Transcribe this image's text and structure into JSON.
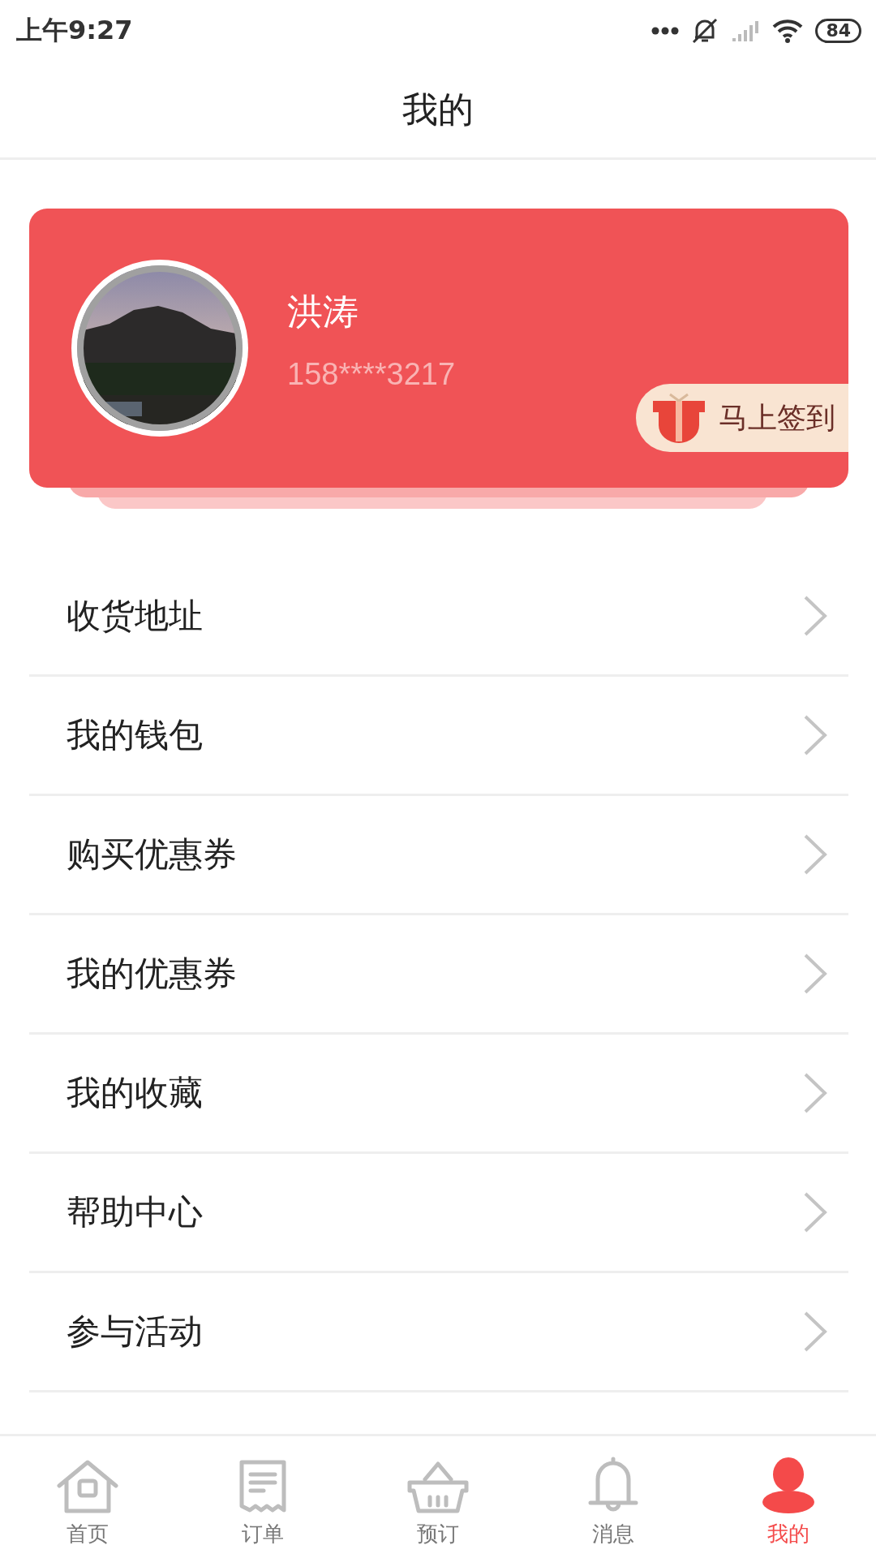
{
  "status_bar": {
    "time": "上午9:27",
    "battery": "84"
  },
  "header": {
    "title": "我的"
  },
  "profile": {
    "name": "洪涛",
    "phone": "158****3217",
    "checkin": "马上签到"
  },
  "menu": [
    {
      "label": "收货地址"
    },
    {
      "label": "我的钱包"
    },
    {
      "label": "购买优惠券"
    },
    {
      "label": "我的优惠券"
    },
    {
      "label": "我的收藏"
    },
    {
      "label": "帮助中心"
    },
    {
      "label": "参与活动"
    }
  ],
  "tab_bar": [
    {
      "label": "首页",
      "kind": "home",
      "selected": false
    },
    {
      "label": "订单",
      "kind": "receipt",
      "selected": false
    },
    {
      "label": "预订",
      "kind": "basket",
      "selected": false
    },
    {
      "label": "消息",
      "kind": "bell",
      "selected": false
    },
    {
      "label": "我的",
      "kind": "person",
      "selected": true
    }
  ]
}
